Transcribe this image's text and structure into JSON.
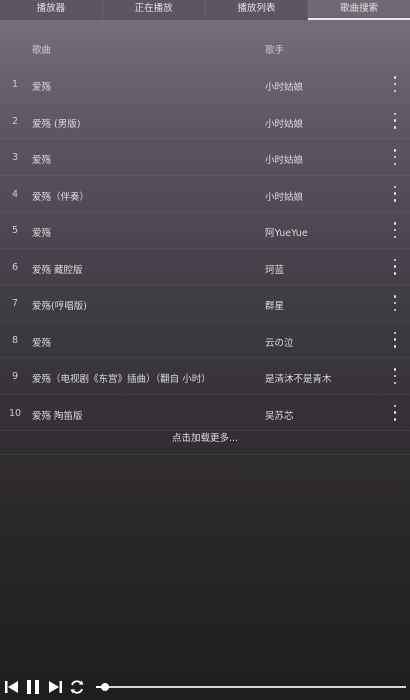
{
  "tabs": [
    {
      "label": "播放器"
    },
    {
      "label": "正在播放"
    },
    {
      "label": "播放列表"
    },
    {
      "label": "歌曲搜索",
      "active": true
    }
  ],
  "header": {
    "title": "歌曲",
    "artist": "歌手"
  },
  "songs": [
    {
      "index": "1",
      "title": "爱殇",
      "artist": "小时姑娘"
    },
    {
      "index": "2",
      "title": "爱殇 (男版)",
      "artist": "小时姑娘"
    },
    {
      "index": "3",
      "title": "爱殇",
      "artist": "小时姑娘"
    },
    {
      "index": "4",
      "title": "爱殇（伴奏）",
      "artist": "小时姑娘"
    },
    {
      "index": "5",
      "title": "爱殇",
      "artist": "阿YueYue"
    },
    {
      "index": "6",
      "title": "爱殇 藏腔版",
      "artist": "珂蓝"
    },
    {
      "index": "7",
      "title": "爱殇(哼唱版)",
      "artist": "群星"
    },
    {
      "index": "8",
      "title": "爱殇",
      "artist": "云の泣"
    },
    {
      "index": "9",
      "title": "爱殇（电视剧《东宫》插曲）（翻自 小时）",
      "artist": "是清沐不是青木"
    },
    {
      "index": "10",
      "title": "爱殇 陶笛版",
      "artist": "吴苏芯"
    }
  ],
  "load_more": "点击加载更多...",
  "player": {
    "progress": 0.03,
    "icons": [
      "skip-previous-icon",
      "pause-icon",
      "skip-next-icon",
      "repeat-icon"
    ]
  }
}
